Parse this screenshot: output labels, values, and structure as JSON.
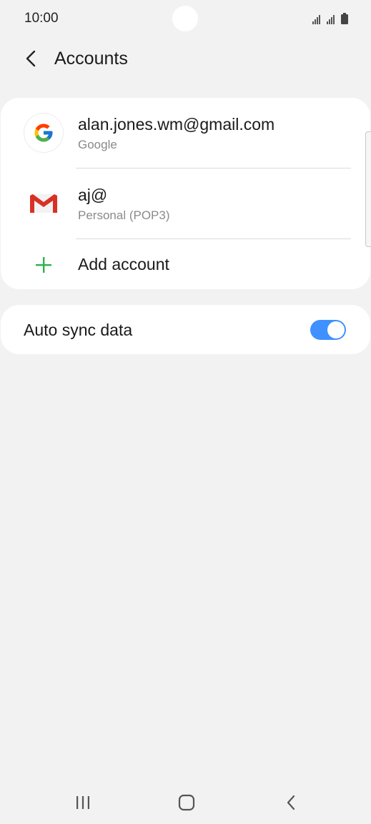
{
  "status_bar": {
    "time": "10:00",
    "icons": [
      "signal-icon",
      "signal-icon",
      "battery-icon"
    ]
  },
  "header": {
    "title": "Accounts",
    "back_icon": "chevron-left-icon"
  },
  "accounts": [
    {
      "title": "alan.jones.wm@gmail.com",
      "subtitle": "Google",
      "icon": "google-icon"
    },
    {
      "title": "aj@",
      "subtitle": "Personal (POP3)",
      "icon": "gmail-icon"
    }
  ],
  "add_account": {
    "label": "Add account",
    "icon": "plus-icon",
    "color": "#2db34a"
  },
  "auto_sync": {
    "label": "Auto sync data",
    "enabled": true,
    "color": "#3e91ff"
  },
  "nav_bar": {
    "icons": [
      "recent-apps-icon",
      "home-icon",
      "back-icon"
    ]
  }
}
